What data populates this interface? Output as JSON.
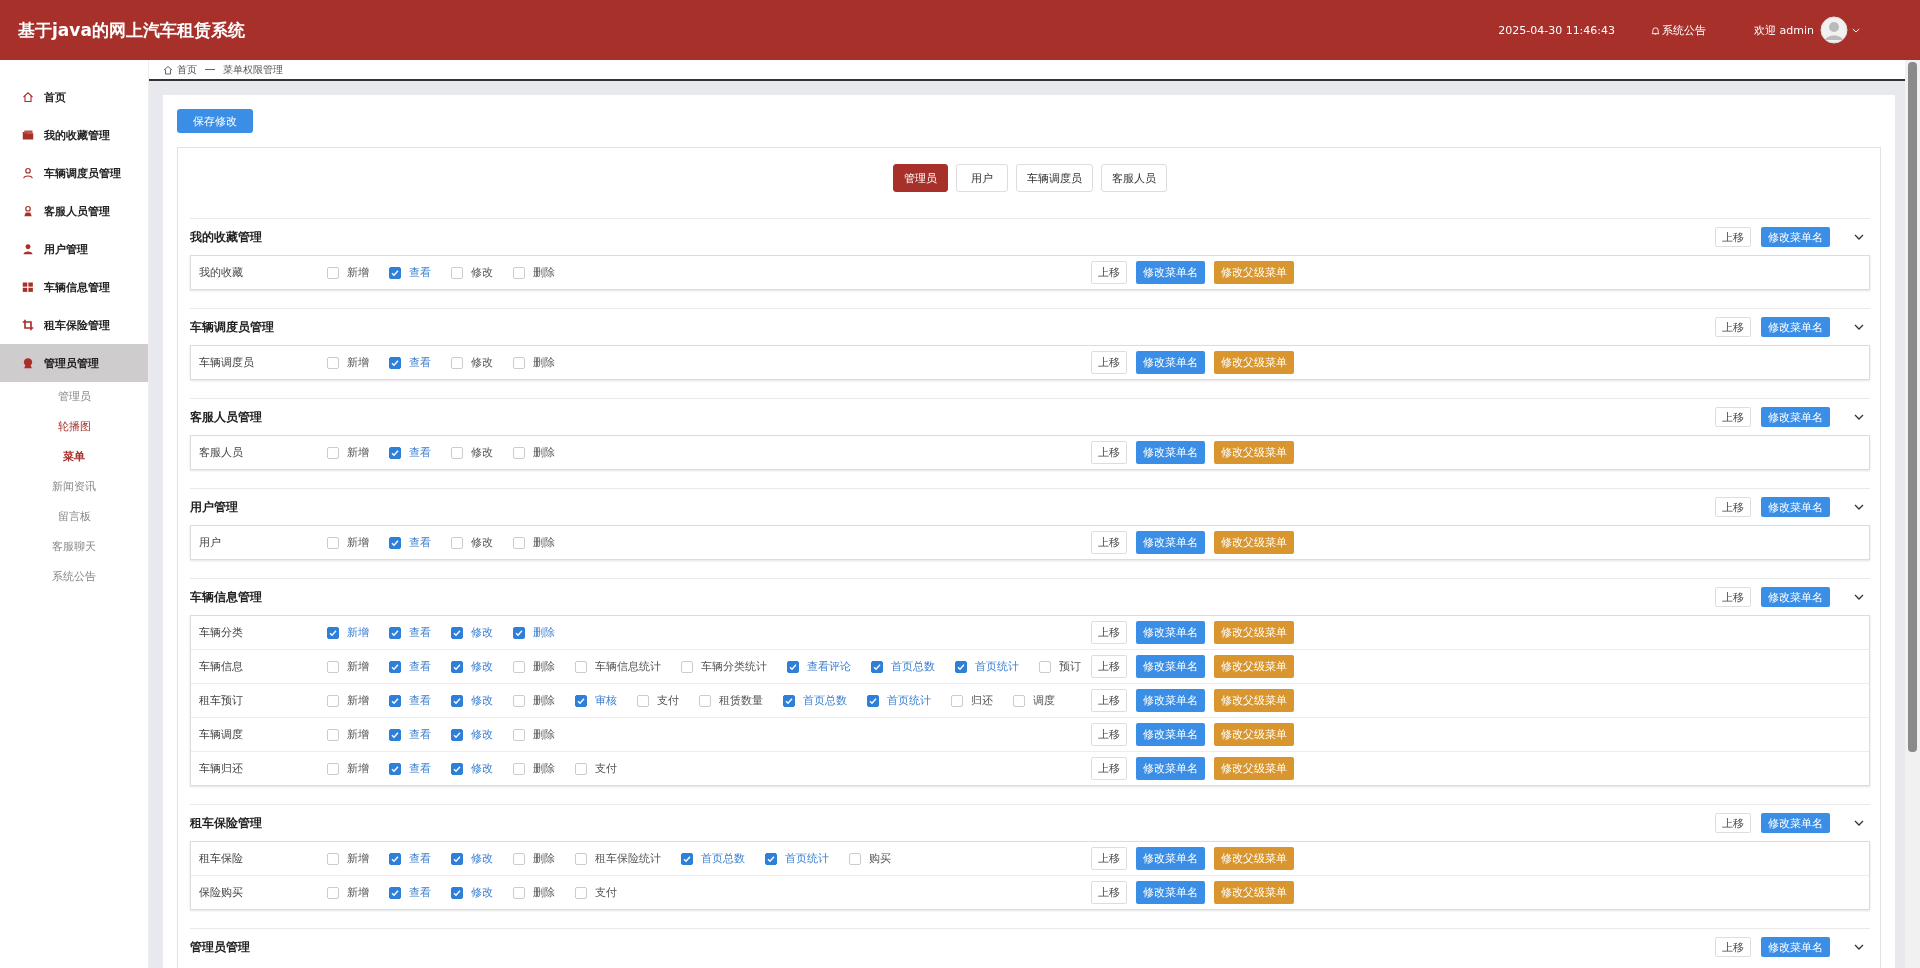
{
  "header": {
    "title": "基于java的网上汽车租赁系统",
    "datetime": "2025-04-30 11:46:43",
    "notice": "系统公告",
    "welcome": "欢迎 admin"
  },
  "sidebar": {
    "items": [
      {
        "label": "首页",
        "selected": false
      },
      {
        "label": "我的收藏管理",
        "selected": false
      },
      {
        "label": "车辆调度员管理",
        "selected": false
      },
      {
        "label": "客服人员管理",
        "selected": false
      },
      {
        "label": "用户管理",
        "selected": false
      },
      {
        "label": "车辆信息管理",
        "selected": false
      },
      {
        "label": "租车保险管理",
        "selected": false
      },
      {
        "label": "管理员管理",
        "selected": true,
        "children": [
          {
            "label": "管理员",
            "selected": false,
            "hovered": false
          },
          {
            "label": "轮播图",
            "selected": false,
            "hovered": true
          },
          {
            "label": "菜单",
            "selected": true,
            "hovered": false
          },
          {
            "label": "新闻资讯",
            "selected": false,
            "hovered": false
          },
          {
            "label": "留言板",
            "selected": false,
            "hovered": false
          },
          {
            "label": "客服聊天",
            "selected": false,
            "hovered": false
          },
          {
            "label": "系统公告",
            "selected": false,
            "hovered": false
          }
        ]
      }
    ]
  },
  "breadcrumb": [
    "首页",
    "菜单权限管理"
  ],
  "save_button": "保存修改",
  "role_tabs": [
    {
      "label": "管理员",
      "selected": true
    },
    {
      "label": "用户",
      "selected": false
    },
    {
      "label": "车辆调度员",
      "selected": false
    },
    {
      "label": "客服人员",
      "selected": false
    }
  ],
  "sections": [
    {
      "title": "我的收藏管理",
      "buttons": [
        "上移",
        "修改菜单名"
      ],
      "items": [
        {
          "name": "我的收藏",
          "buttons": [
            "上移",
            "修改菜单名",
            "修改父级菜单"
          ],
          "perms": [
            {
              "label": "新增",
              "checked": false
            },
            {
              "label": "查看",
              "checked": true
            },
            {
              "label": "修改",
              "checked": false
            },
            {
              "label": "删除",
              "checked": false
            }
          ]
        }
      ]
    },
    {
      "title": "车辆调度员管理",
      "buttons": [
        "上移",
        "修改菜单名"
      ],
      "items": [
        {
          "name": "车辆调度员",
          "buttons": [
            "上移",
            "修改菜单名",
            "修改父级菜单"
          ],
          "perms": [
            {
              "label": "新增",
              "checked": false
            },
            {
              "label": "查看",
              "checked": true
            },
            {
              "label": "修改",
              "checked": false
            },
            {
              "label": "删除",
              "checked": false
            }
          ]
        }
      ]
    },
    {
      "title": "客服人员管理",
      "buttons": [
        "上移",
        "修改菜单名"
      ],
      "items": [
        {
          "name": "客服人员",
          "buttons": [
            "上移",
            "修改菜单名",
            "修改父级菜单"
          ],
          "perms": [
            {
              "label": "新增",
              "checked": false
            },
            {
              "label": "查看",
              "checked": true
            },
            {
              "label": "修改",
              "checked": false
            },
            {
              "label": "删除",
              "checked": false
            }
          ]
        }
      ]
    },
    {
      "title": "用户管理",
      "buttons": [
        "上移",
        "修改菜单名"
      ],
      "items": [
        {
          "name": "用户",
          "buttons": [
            "上移",
            "修改菜单名",
            "修改父级菜单"
          ],
          "perms": [
            {
              "label": "新增",
              "checked": false
            },
            {
              "label": "查看",
              "checked": true
            },
            {
              "label": "修改",
              "checked": false
            },
            {
              "label": "删除",
              "checked": false
            }
          ]
        }
      ]
    },
    {
      "title": "车辆信息管理",
      "buttons": [
        "上移",
        "修改菜单名"
      ],
      "items": [
        {
          "name": "车辆分类",
          "buttons": [
            "上移",
            "修改菜单名",
            "修改父级菜单"
          ],
          "perms": [
            {
              "label": "新增",
              "checked": true
            },
            {
              "label": "查看",
              "checked": true
            },
            {
              "label": "修改",
              "checked": true
            },
            {
              "label": "删除",
              "checked": true
            }
          ]
        },
        {
          "name": "车辆信息",
          "buttons": [
            "上移",
            "修改菜单名",
            "修改父级菜单"
          ],
          "perms": [
            {
              "label": "新增",
              "checked": false
            },
            {
              "label": "查看",
              "checked": true
            },
            {
              "label": "修改",
              "checked": true
            },
            {
              "label": "删除",
              "checked": false
            },
            {
              "label": "车辆信息统计",
              "checked": false
            },
            {
              "label": "车辆分类统计",
              "checked": false
            },
            {
              "label": "查看评论",
              "checked": true
            },
            {
              "label": "首页总数",
              "checked": true
            },
            {
              "label": "首页统计",
              "checked": true
            },
            {
              "label": "预订",
              "checked": false
            }
          ]
        },
        {
          "name": "租车预订",
          "buttons": [
            "上移",
            "修改菜单名",
            "修改父级菜单"
          ],
          "perms": [
            {
              "label": "新增",
              "checked": false
            },
            {
              "label": "查看",
              "checked": true
            },
            {
              "label": "修改",
              "checked": true
            },
            {
              "label": "删除",
              "checked": false
            },
            {
              "label": "审核",
              "checked": true
            },
            {
              "label": "支付",
              "checked": false
            },
            {
              "label": "租赁数量",
              "checked": false
            },
            {
              "label": "首页总数",
              "checked": true
            },
            {
              "label": "首页统计",
              "checked": true
            },
            {
              "label": "归还",
              "checked": false
            },
            {
              "label": "调度",
              "checked": false
            }
          ]
        },
        {
          "name": "车辆调度",
          "buttons": [
            "上移",
            "修改菜单名",
            "修改父级菜单"
          ],
          "perms": [
            {
              "label": "新增",
              "checked": false
            },
            {
              "label": "查看",
              "checked": true
            },
            {
              "label": "修改",
              "checked": true
            },
            {
              "label": "删除",
              "checked": false
            }
          ]
        },
        {
          "name": "车辆归还",
          "buttons": [
            "上移",
            "修改菜单名",
            "修改父级菜单"
          ],
          "perms": [
            {
              "label": "新增",
              "checked": false
            },
            {
              "label": "查看",
              "checked": true
            },
            {
              "label": "修改",
              "checked": true
            },
            {
              "label": "删除",
              "checked": false
            },
            {
              "label": "支付",
              "checked": false
            }
          ]
        }
      ]
    },
    {
      "title": "租车保险管理",
      "buttons": [
        "上移",
        "修改菜单名"
      ],
      "items": [
        {
          "name": "租车保险",
          "buttons": [
            "上移",
            "修改菜单名",
            "修改父级菜单"
          ],
          "perms": [
            {
              "label": "新增",
              "checked": false
            },
            {
              "label": "查看",
              "checked": true
            },
            {
              "label": "修改",
              "checked": true
            },
            {
              "label": "删除",
              "checked": false
            },
            {
              "label": "租车保险统计",
              "checked": false
            },
            {
              "label": "首页总数",
              "checked": true
            },
            {
              "label": "首页统计",
              "checked": true
            },
            {
              "label": "购买",
              "checked": false
            }
          ]
        },
        {
          "name": "保险购买",
          "buttons": [
            "上移",
            "修改菜单名",
            "修改父级菜单"
          ],
          "perms": [
            {
              "label": "新增",
              "checked": false
            },
            {
              "label": "查看",
              "checked": true
            },
            {
              "label": "修改",
              "checked": true
            },
            {
              "label": "删除",
              "checked": false
            },
            {
              "label": "支付",
              "checked": false
            }
          ]
        }
      ]
    },
    {
      "title": "管理员管理",
      "buttons": [
        "上移",
        "修改菜单名"
      ]
    }
  ]
}
